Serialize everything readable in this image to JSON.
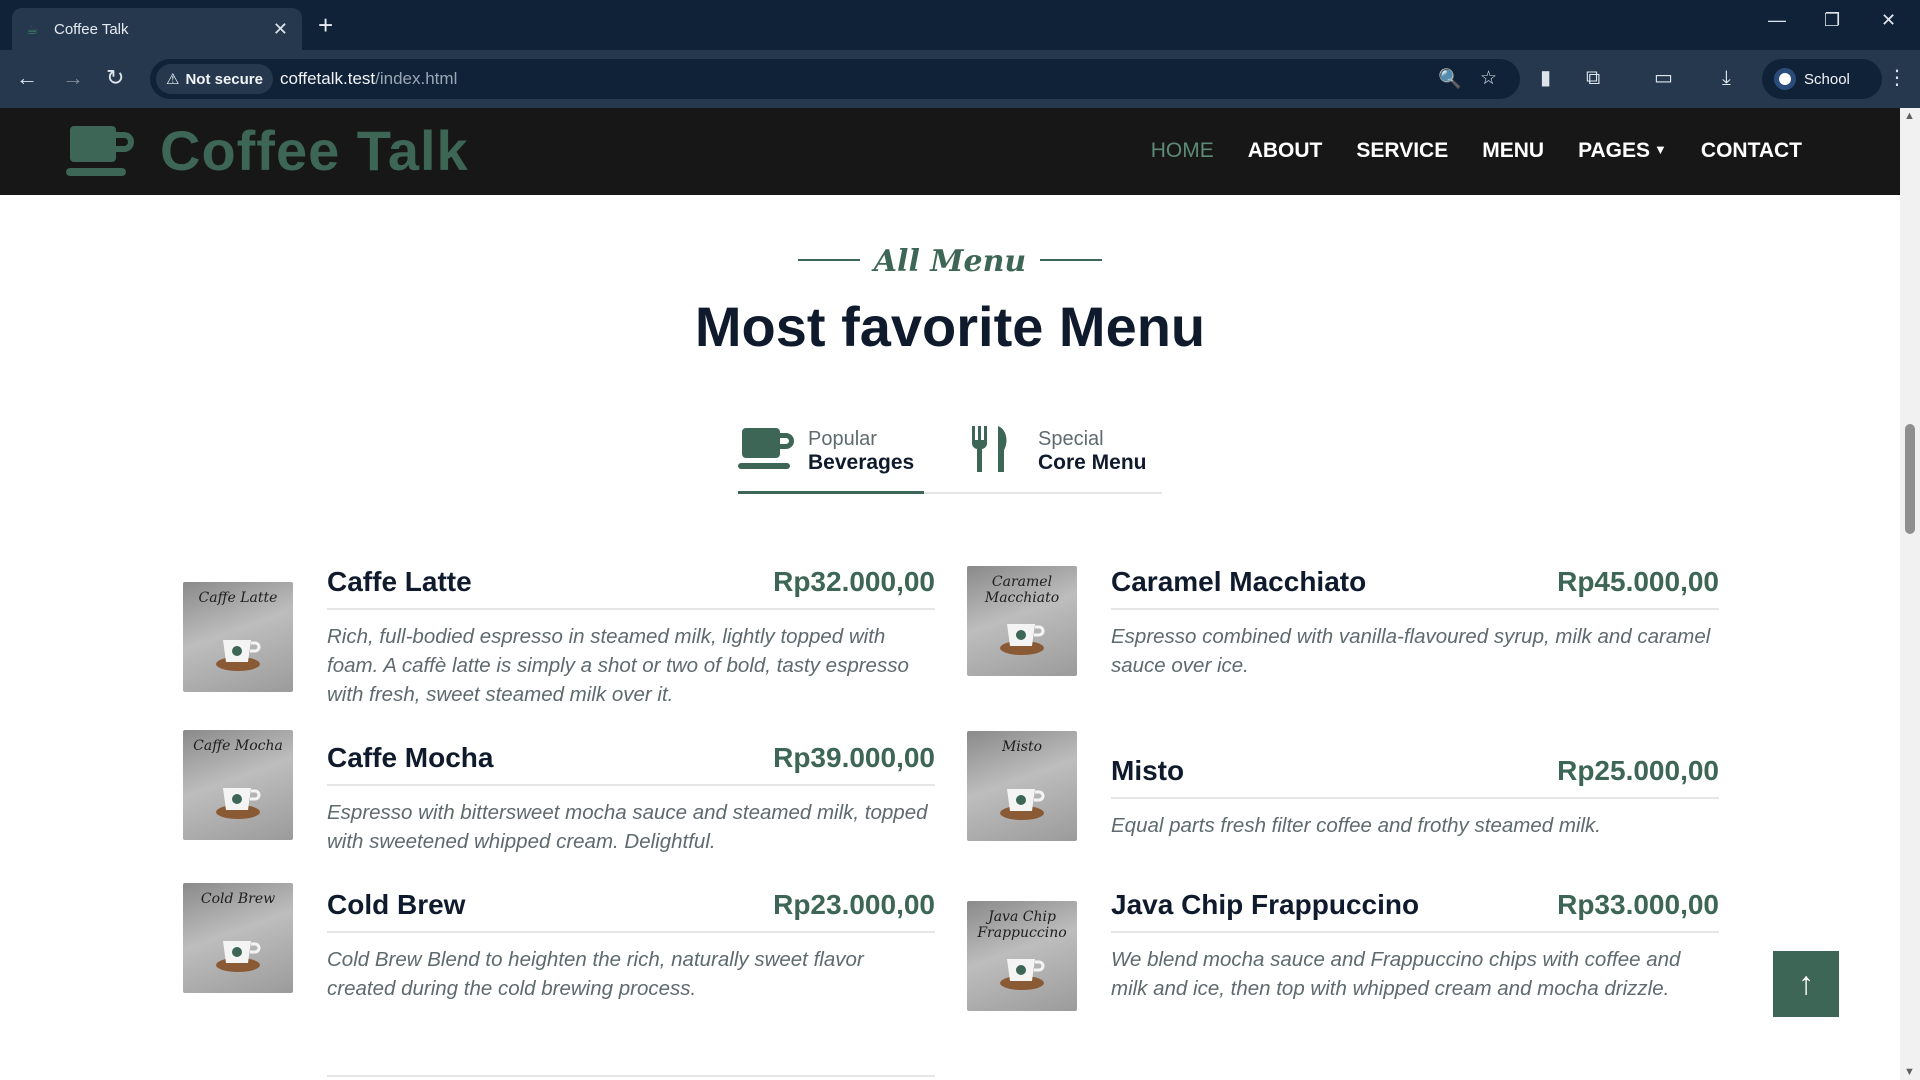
{
  "browser": {
    "tab_title": "Coffee Talk",
    "new_tab": "+",
    "not_secure": "Not secure",
    "url_host": "coffetalk.test",
    "url_path": "/index.html",
    "profile": "School"
  },
  "site": {
    "brand": "Coffee Talk",
    "nav": {
      "home": "HOME",
      "about": "ABOUT",
      "service": "SERVICE",
      "menu": "MENU",
      "pages": "PAGES",
      "contact": "CONTACT"
    }
  },
  "section": {
    "eyebrow": "All Menu",
    "title": "Most favorite Menu"
  },
  "tabs": [
    {
      "small": "Popular",
      "big": "Beverages",
      "icon": "coffee-cup-icon"
    },
    {
      "small": "Special",
      "big": "Core Menu",
      "icon": "utensils-icon"
    }
  ],
  "items": [
    {
      "name": "Caffe Latte",
      "price": "Rp32.000,00",
      "desc": "Rich, full-bodied espresso in steamed milk, lightly topped with foam. A caffè latte is simply a shot or two of bold, tasty espresso with fresh, sweet steamed milk over it.",
      "thumb_text": "Caffe Latte"
    },
    {
      "name": "Caramel Macchiato",
      "price": "Rp45.000,00",
      "desc": "Espresso combined with vanilla-flavoured syrup, milk and caramel sauce over ice.",
      "thumb_text": "Caramel Macchiato"
    },
    {
      "name": "Caffe Mocha",
      "price": "Rp39.000,00",
      "desc": "Espresso with bittersweet mocha sauce and steamed milk, topped with sweetened whipped cream. Delightful.",
      "thumb_text": "Caffe Mocha"
    },
    {
      "name": "Misto",
      "price": "Rp25.000,00",
      "desc": "Equal parts fresh filter coffee and frothy steamed milk.",
      "thumb_text": "Misto"
    },
    {
      "name": "Cold Brew",
      "price": "Rp23.000,00",
      "desc": "Cold Brew Blend to heighten the rich, naturally sweet flavor created during the cold brewing process.",
      "thumb_text": "Cold Brew"
    },
    {
      "name": "Java Chip Frappuccino",
      "price": "Rp33.000,00",
      "desc": "We blend mocha sauce and Frappuccino chips with coffee and milk and ice, then top with whipped cream and mocha drizzle.",
      "thumb_text": "Java Chip Frappuccino"
    }
  ],
  "colors": {
    "brand_green": "#3d6656",
    "navbar_bg": "#171717",
    "heading": "#0f1b2d"
  }
}
